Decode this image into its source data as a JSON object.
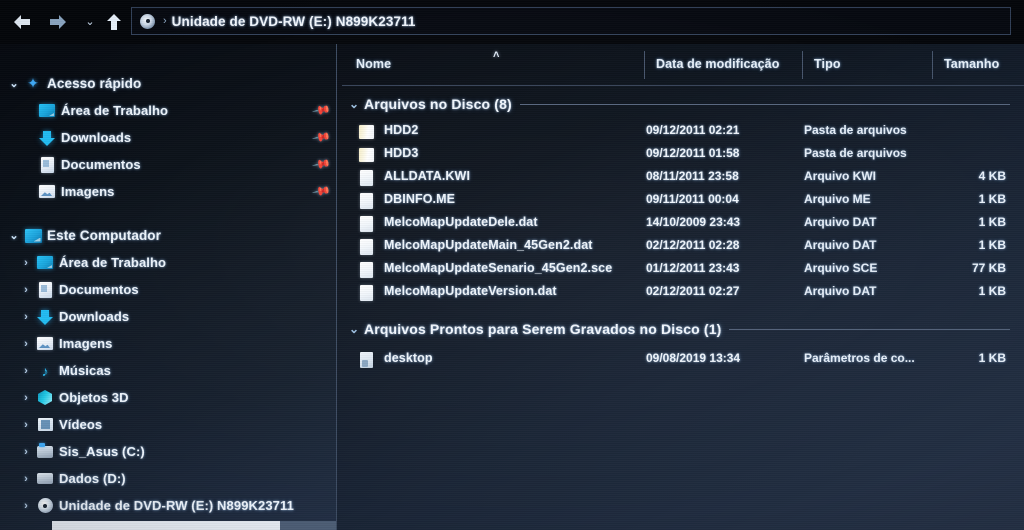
{
  "window": {
    "title": "Unidade de DVD-RW (E:) N899K23711"
  },
  "nav": {
    "back_icon": "back-arrow-icon",
    "forward_icon": "forward-arrow-icon",
    "recent_icon": "chevron-down-icon",
    "up_icon": "up-arrow-icon",
    "recent_glyph": "⌄",
    "address_separator": "›",
    "address_icon": "dvd-disc-icon",
    "address_text": "Unidade de DVD-RW (E:) N899K23711"
  },
  "columns": {
    "name": "Nome",
    "date": "Data de modificação",
    "type": "Tipo",
    "size": "Tamanho",
    "sort_caret": "˄"
  },
  "sidebar": {
    "quick_access": {
      "label": "Acesso rápido",
      "icon": "star-icon",
      "chevron": "⌄",
      "items": [
        {
          "label": "Área de Trabalho",
          "icon": "desktop-icon",
          "pinned": true
        },
        {
          "label": "Downloads",
          "icon": "download-icon",
          "pinned": true
        },
        {
          "label": "Documentos",
          "icon": "documents-icon",
          "pinned": true
        },
        {
          "label": "Imagens",
          "icon": "pictures-icon",
          "pinned": true
        }
      ]
    },
    "this_pc": {
      "label": "Este Computador",
      "icon": "this-pc-icon",
      "chevron": "⌄",
      "items": [
        {
          "label": "Área de Trabalho",
          "icon": "desktop-icon",
          "chevron": "›"
        },
        {
          "label": "Documentos",
          "icon": "documents-icon",
          "chevron": "›"
        },
        {
          "label": "Downloads",
          "icon": "download-icon",
          "chevron": "›"
        },
        {
          "label": "Imagens",
          "icon": "pictures-icon",
          "chevron": "›"
        },
        {
          "label": "Músicas",
          "icon": "music-icon",
          "chevron": "›"
        },
        {
          "label": "Objetos 3D",
          "icon": "objects3d-icon",
          "chevron": "›"
        },
        {
          "label": "Vídeos",
          "icon": "videos-icon",
          "chevron": "›"
        },
        {
          "label": "Sis_Asus (C:)",
          "icon": "system-drive-icon",
          "chevron": "›"
        },
        {
          "label": "Dados (D:)",
          "icon": "drive-icon",
          "chevron": "›"
        },
        {
          "label": "Unidade de DVD-RW (E:) N899K23711",
          "icon": "dvd-drive-icon",
          "chevron": "›"
        }
      ]
    },
    "pin_glyph": "📌"
  },
  "groups": [
    {
      "label": "Arquivos no Disco (8)",
      "chevron": "⌄",
      "rows": [
        {
          "name": "HDD2",
          "date": "09/12/2011 02:21",
          "type": "Pasta de arquivos",
          "size": "",
          "icon": "folder-icon"
        },
        {
          "name": "HDD3",
          "date": "09/12/2011 01:58",
          "type": "Pasta de arquivos",
          "size": "",
          "icon": "folder-icon"
        },
        {
          "name": "ALLDATA.KWI",
          "date": "08/11/2011 23:58",
          "type": "Arquivo KWI",
          "size": "4 KB",
          "icon": "file-icon"
        },
        {
          "name": "DBINFO.ME",
          "date": "09/11/2011 00:04",
          "type": "Arquivo ME",
          "size": "1 KB",
          "icon": "file-icon"
        },
        {
          "name": "MelcoMapUpdateDele.dat",
          "date": "14/10/2009 23:43",
          "type": "Arquivo DAT",
          "size": "1 KB",
          "icon": "file-icon"
        },
        {
          "name": "MelcoMapUpdateMain_45Gen2.dat",
          "date": "02/12/2011 02:28",
          "type": "Arquivo DAT",
          "size": "1 KB",
          "icon": "file-icon"
        },
        {
          "name": "MelcoMapUpdateSenario_45Gen2.sce",
          "date": "01/12/2011 23:43",
          "type": "Arquivo SCE",
          "size": "77 KB",
          "icon": "file-icon"
        },
        {
          "name": "MelcoMapUpdateVersion.dat",
          "date": "02/12/2011 02:27",
          "type": "Arquivo DAT",
          "size": "1 KB",
          "icon": "file-icon"
        }
      ]
    },
    {
      "label": "Arquivos Prontos para Serem Gravados no Disco (1)",
      "chevron": "⌄",
      "rows": [
        {
          "name": "desktop",
          "date": "09/08/2019 13:34",
          "type": "Parâmetros de co...",
          "size": "1 KB",
          "icon": "config-file-icon"
        }
      ]
    }
  ],
  "colors": {
    "accent": "#3fa9f5",
    "text": "#f0f6fc",
    "pane_bg": "#1a2536",
    "sidebar_bg": "#16202e"
  }
}
